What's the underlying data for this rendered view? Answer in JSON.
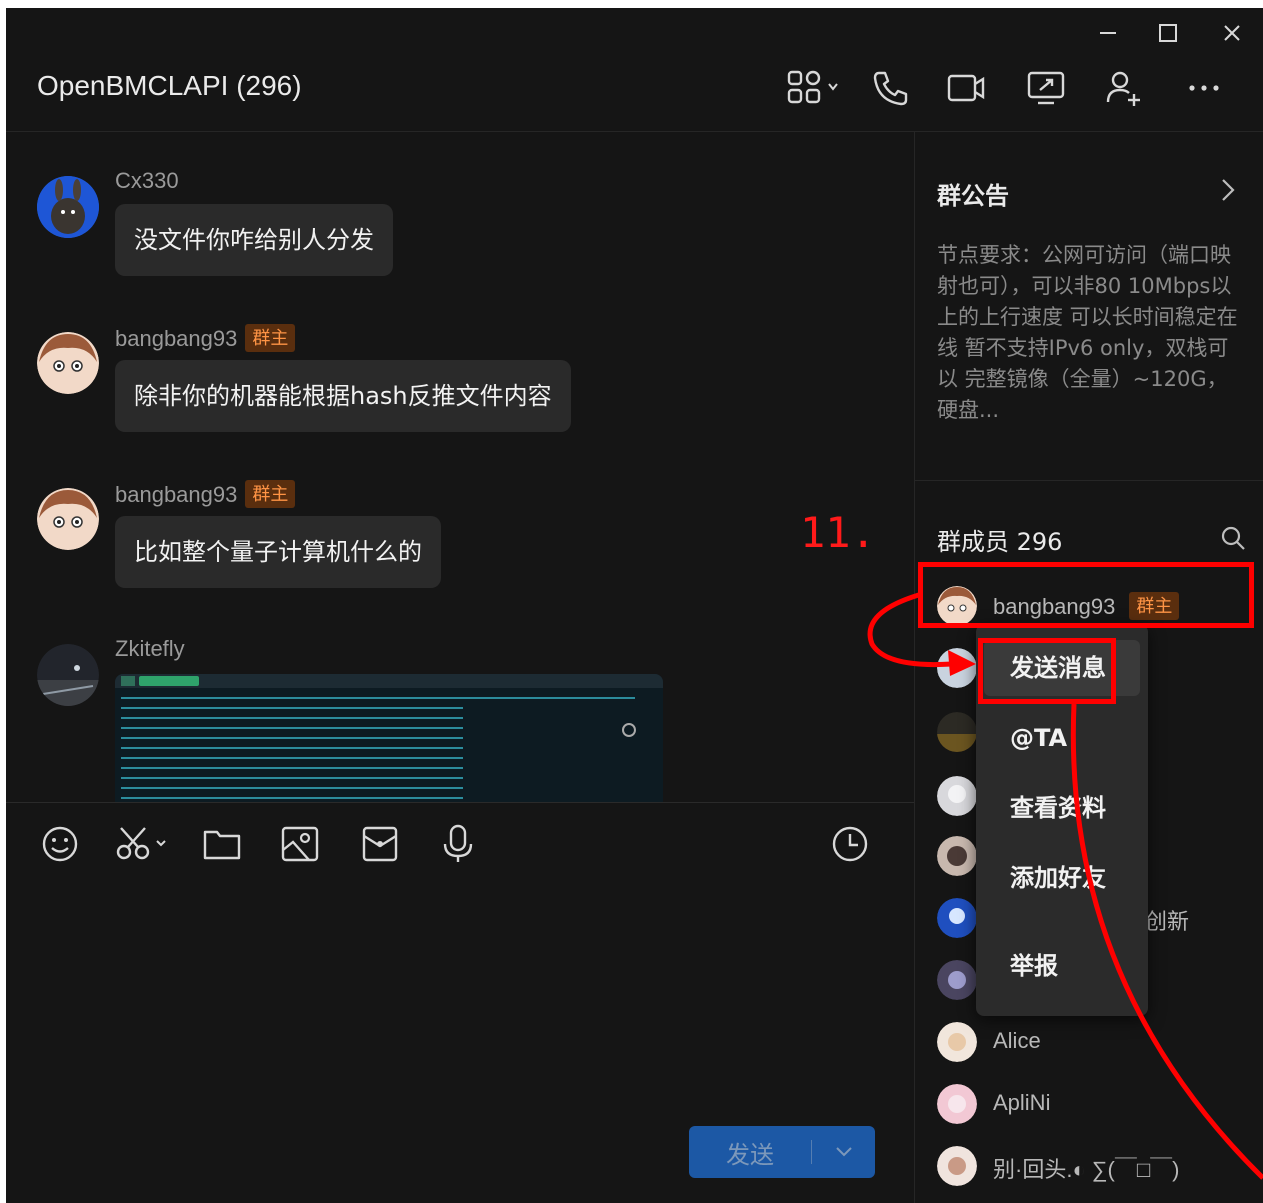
{
  "window": {
    "title": "OpenBMCLAPI (296)",
    "controls": [
      "minimize-icon",
      "maximize-icon",
      "close-icon"
    ]
  },
  "header_icons": [
    "apps-icon",
    "phone-icon",
    "video-icon",
    "screen-share-icon",
    "add-member-icon",
    "more-icon"
  ],
  "messages": [
    {
      "sender": "Cx330",
      "badge": "",
      "text": "没文件你咋给别人分发"
    },
    {
      "sender": "bangbang93",
      "badge": "群主",
      "text": "除非你的机器能根据hash反推文件内容"
    },
    {
      "sender": "bangbang93",
      "badge": "群主",
      "text": "比如整个量子计算机什么的"
    },
    {
      "sender": "Zkitefly",
      "badge": "",
      "text": ""
    }
  ],
  "toolbar_icons": [
    "emoji-icon",
    "scissors-icon",
    "folder-icon",
    "image-icon",
    "red-packet-icon",
    "microphone-icon",
    "history-icon"
  ],
  "send": {
    "label": "发送"
  },
  "notice": {
    "title": "群公告",
    "text": "节点要求：公网可访问（端口映射也可），可以非80 10Mbps以上的上行速度 可以长时间稳定在线 暂不支持IPv6 only，双栈可以 完整镜像（全量）~120G，硬盘..."
  },
  "members": {
    "title": "群成员 296",
    "list": [
      {
        "name": "bangbang93",
        "badge": "群主"
      },
      {
        "name": "",
        "badge": ""
      },
      {
        "name": "",
        "badge": ""
      },
      {
        "name": "",
        "badge": ""
      },
      {
        "name": "",
        "badge": ""
      },
      {
        "name": "创新",
        "badge": ""
      },
      {
        "name": "",
        "badge": ""
      },
      {
        "name": "Alice",
        "badge": ""
      },
      {
        "name": "ApliNi",
        "badge": ""
      },
      {
        "name": "别·回头.◐ ∑(￣□￣)",
        "badge": ""
      }
    ]
  },
  "context_menu": {
    "items": [
      "发送消息",
      "@TA",
      "查看资料",
      "添加好友",
      "举报"
    ]
  },
  "annotation": {
    "label": "11.",
    "color": "#ff0000"
  }
}
